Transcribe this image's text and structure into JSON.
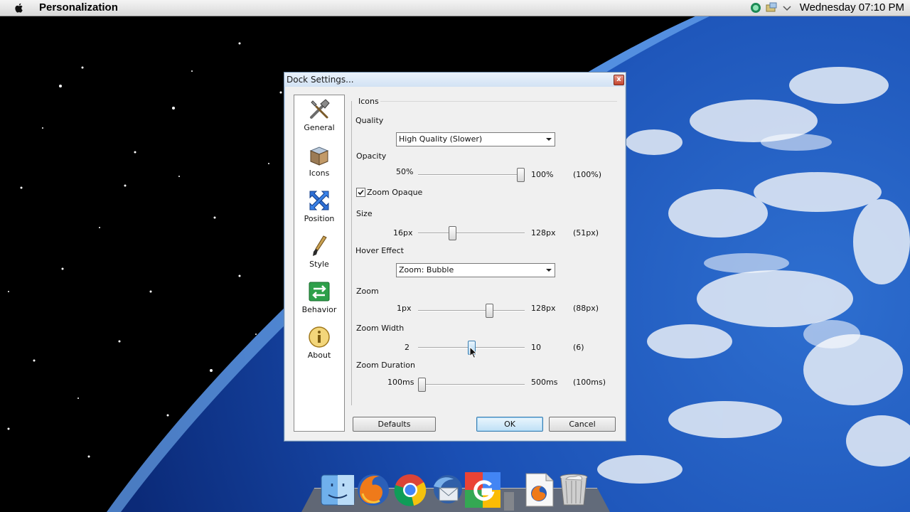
{
  "menubar": {
    "apple_icon": "apple-icon",
    "app_name": "Personalization",
    "tray_icons": [
      "messenger-icon",
      "network-icon",
      "chevron-down-icon"
    ],
    "clock": "Wednesday 07:10 PM"
  },
  "dialog": {
    "title": "Dock Settings...",
    "close_label": "x",
    "sidebar": [
      {
        "label": "General",
        "icon": "tools-icon"
      },
      {
        "label": "Icons",
        "icon": "box-icon"
      },
      {
        "label": "Position",
        "icon": "arrows-icon"
      },
      {
        "label": "Style",
        "icon": "brush-icon"
      },
      {
        "label": "Behavior",
        "icon": "behavior-icon"
      },
      {
        "label": "About",
        "icon": "info-icon"
      }
    ],
    "panel_title": "Icons",
    "quality": {
      "label": "Quality",
      "value": "High Quality (Slower)"
    },
    "opacity": {
      "label": "Opacity",
      "min": "50%",
      "max": "100%",
      "current": "(100%)",
      "fraction": 1.0
    },
    "zoom_opaque": {
      "label": "Zoom Opaque",
      "checked": true
    },
    "size": {
      "label": "Size",
      "min": "16px",
      "max": "128px",
      "current": "(51px)",
      "fraction": 0.3125
    },
    "hover_effect": {
      "label": "Hover Effect",
      "value": "Zoom: Bubble"
    },
    "zoom": {
      "label": "Zoom",
      "min": "1px",
      "max": "128px",
      "current": "(88px)",
      "fraction": 0.685
    },
    "zoom_width": {
      "label": "Zoom Width",
      "min": "2",
      "max": "10",
      "current": "(6)",
      "fraction": 0.5
    },
    "zoom_duration": {
      "label": "Zoom Duration",
      "min": "100ms",
      "max": "500ms",
      "current": "(100ms)",
      "fraction": 0.0
    },
    "buttons": {
      "defaults": "Defaults",
      "ok": "OK",
      "cancel": "Cancel"
    }
  },
  "dock": {
    "items": [
      "finder-icon",
      "firefox-icon",
      "chrome-icon",
      "thunderbird-icon",
      "google-icon",
      "firefox-document-icon",
      "trash-icon"
    ]
  },
  "colors": {
    "accent": "#3c7fb1",
    "title_gradient_top": "#eaf2fb",
    "close_red": "#c3432c"
  }
}
